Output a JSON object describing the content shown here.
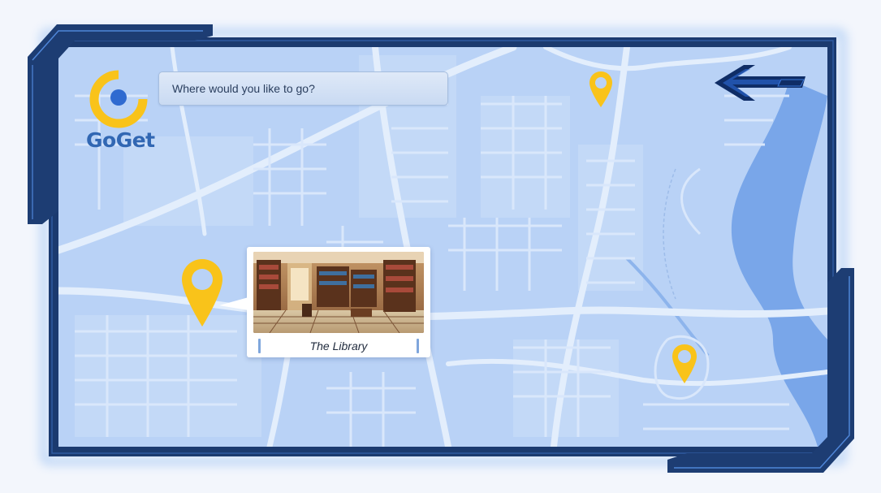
{
  "app": {
    "logo_text": "GoGet",
    "brand_color": "#3167b3",
    "accent_color": "#f9c31a"
  },
  "search": {
    "text": "Where would you like to go?"
  },
  "navigation": {
    "back_icon": "back-arrow-icon"
  },
  "map": {
    "background_color": "#b9d2f6",
    "road_color": "#e3eefc",
    "river_color": "#6d9fe6",
    "pins": [
      {
        "name": "location-pin-north",
        "selected": false
      },
      {
        "name": "location-pin-library",
        "selected": true
      },
      {
        "name": "location-pin-east",
        "selected": false
      }
    ]
  },
  "location_card": {
    "title": "The Library",
    "image": "library-interior"
  }
}
